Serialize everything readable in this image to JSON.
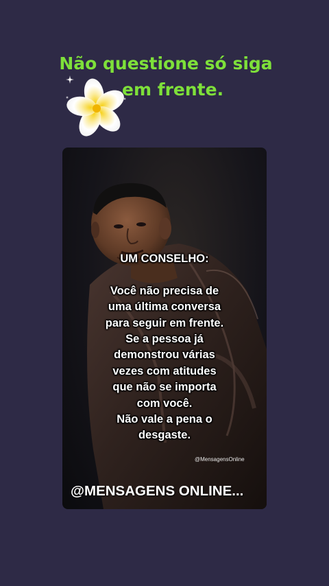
{
  "header": {
    "title_line1": "Não questione só siga",
    "title_line2": "em frente.",
    "title_color": "#7ee03a",
    "decoration_icon": "frangipani-flower-icon"
  },
  "card": {
    "photo_icon": "portrait-photo",
    "message": {
      "heading": "UM CONSELHO:",
      "lines": [
        "Você não precisa de",
        "uma última conversa",
        "para seguir em frente.",
        "Se a pessoa já",
        "demonstrou várias",
        "vezes com atitudes",
        "que não se importa",
        "com você.",
        "Não vale a pena o",
        "desgaste."
      ]
    },
    "watermark_small": "@MensagensOnline",
    "watermark_big": "@MENSAGENS ONLINE..."
  },
  "colors": {
    "background": "#2e2a46",
    "text": "#ffffff"
  }
}
